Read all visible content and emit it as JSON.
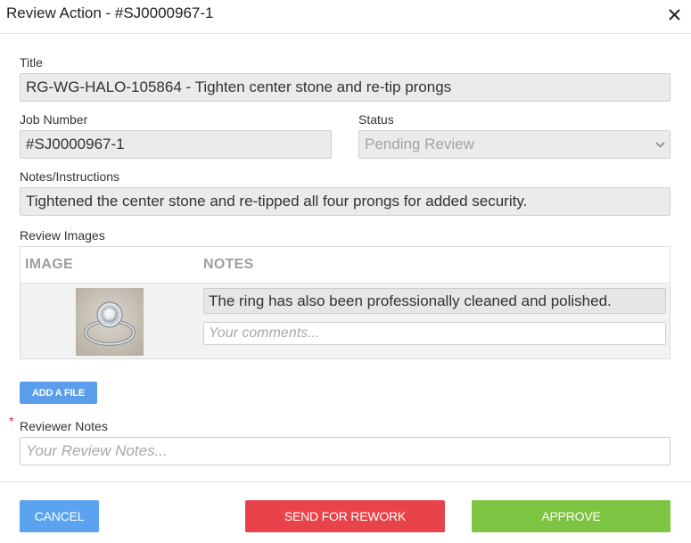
{
  "dialog": {
    "title": "Review Action - #SJ0000967-1"
  },
  "form": {
    "title_label": "Title",
    "title_value": "RG-WG-HALO-105864 - Tighten center stone and re-tip prongs",
    "job_number_label": "Job Number",
    "job_number_value": "#SJ0000967-1",
    "status_label": "Status",
    "status_value": "Pending Review",
    "notes_label": "Notes/Instructions",
    "notes_value": "Tightened the center stone and re-tipped all four prongs for added security."
  },
  "review_images": {
    "label": "Review Images",
    "columns": [
      "IMAGE",
      "NOTES"
    ],
    "rows": [
      {
        "image": "ring-thumbnail",
        "note": "The ring has also been professionally cleaned and polished.",
        "comment_placeholder": "Your comments..."
      }
    ]
  },
  "add_file_label": "ADD A FILE",
  "reviewer_notes": {
    "required_mark": "*",
    "label": "Reviewer Notes",
    "placeholder": "Your Review Notes..."
  },
  "buttons": {
    "cancel": "CANCEL",
    "rework": "SEND FOR REWORK",
    "approve": "APPROVE"
  },
  "icons": {
    "close": "close-icon",
    "status_dropdown": "chevron-down-icon"
  },
  "colors": {
    "cancel": "#5ba3ee",
    "rework": "#e8434a",
    "approve": "#7dc443",
    "add_file": "#5b9dea",
    "required": "#e03030"
  }
}
